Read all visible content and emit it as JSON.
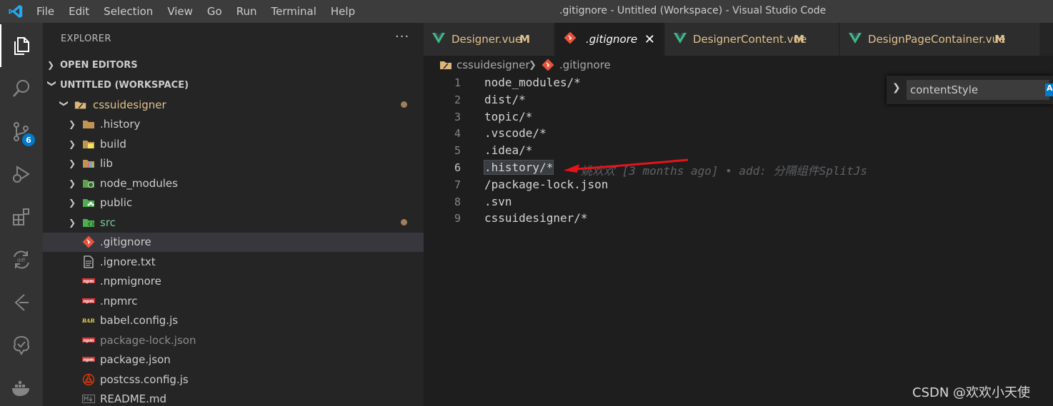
{
  "window": {
    "title": ".gitignore - Untitled (Workspace) - Visual Studio Code"
  },
  "menu": [
    "File",
    "Edit",
    "Selection",
    "View",
    "Go",
    "Run",
    "Terminal",
    "Help"
  ],
  "activity_bar": {
    "items": [
      "explorer-icon",
      "search-icon",
      "source-control-icon",
      "run-debug-icon",
      "extensions-icon",
      "git-diff-icon",
      "timeline-icon",
      "tree-icon",
      "docker-icon"
    ],
    "scm_badge": "6"
  },
  "sidebar": {
    "title": "EXPLORER",
    "more": "···",
    "open_editors": "OPEN EDITORS",
    "workspace": "UNTITLED (WORKSPACE)",
    "tree": [
      {
        "label": "cssuidesigner",
        "type": "root-folder",
        "color": "#e2c08d",
        "dot": true
      },
      {
        "label": ".history",
        "type": "folder",
        "icon": "folder-icon"
      },
      {
        "label": "build",
        "type": "folder",
        "icon": "folder-build-icon"
      },
      {
        "label": "lib",
        "type": "folder",
        "icon": "folder-lib-icon"
      },
      {
        "label": "node_modules",
        "type": "folder",
        "icon": "folder-node-icon"
      },
      {
        "label": "public",
        "type": "folder",
        "icon": "folder-public-icon"
      },
      {
        "label": "src",
        "type": "folder",
        "icon": "folder-src-icon",
        "color": "#73c991",
        "dot": true
      },
      {
        "label": ".gitignore",
        "type": "file",
        "icon": "git-icon",
        "selected": true
      },
      {
        "label": ".ignore.txt",
        "type": "file",
        "icon": "text-file-icon"
      },
      {
        "label": ".npmignore",
        "type": "file",
        "icon": "npm-icon"
      },
      {
        "label": ".npmrc",
        "type": "file",
        "icon": "npm-icon"
      },
      {
        "label": "babel.config.js",
        "type": "file",
        "icon": "babel-icon"
      },
      {
        "label": "package-lock.json",
        "type": "file",
        "icon": "npm-icon",
        "muted": true
      },
      {
        "label": "package.json",
        "type": "file",
        "icon": "npm-icon"
      },
      {
        "label": "postcss.config.js",
        "type": "file",
        "icon": "postcss-icon"
      },
      {
        "label": "README.md",
        "type": "file",
        "icon": "markdown-icon"
      }
    ]
  },
  "tabs": [
    {
      "label": "Designer.vue",
      "mark": "M",
      "icon": "vue-icon"
    },
    {
      "label": ".gitignore",
      "icon": "git-icon",
      "active": true
    },
    {
      "label": "DesignerContent.vue",
      "mark": "M",
      "icon": "vue-icon"
    },
    {
      "label": "DesignPageContainer.vue",
      "mark": "M",
      "icon": "vue-icon"
    }
  ],
  "breadcrumbs": [
    "cssuidesigner",
    ".gitignore"
  ],
  "editor": {
    "current_line": 6,
    "lines": [
      "node_modules/*",
      "dist/*",
      "topic/*",
      ".vscode/*",
      ".idea/*",
      ".history/*",
      "/package-lock.json",
      ".svn",
      "cssuidesigner/*"
    ],
    "blame": "姚欢欢 [3 months ago] • add: 分隔组件SplitJs"
  },
  "outline_widget": {
    "value": "contentStyle",
    "toggle": "A"
  },
  "watermark": "CSDN @欢欢小天使"
}
